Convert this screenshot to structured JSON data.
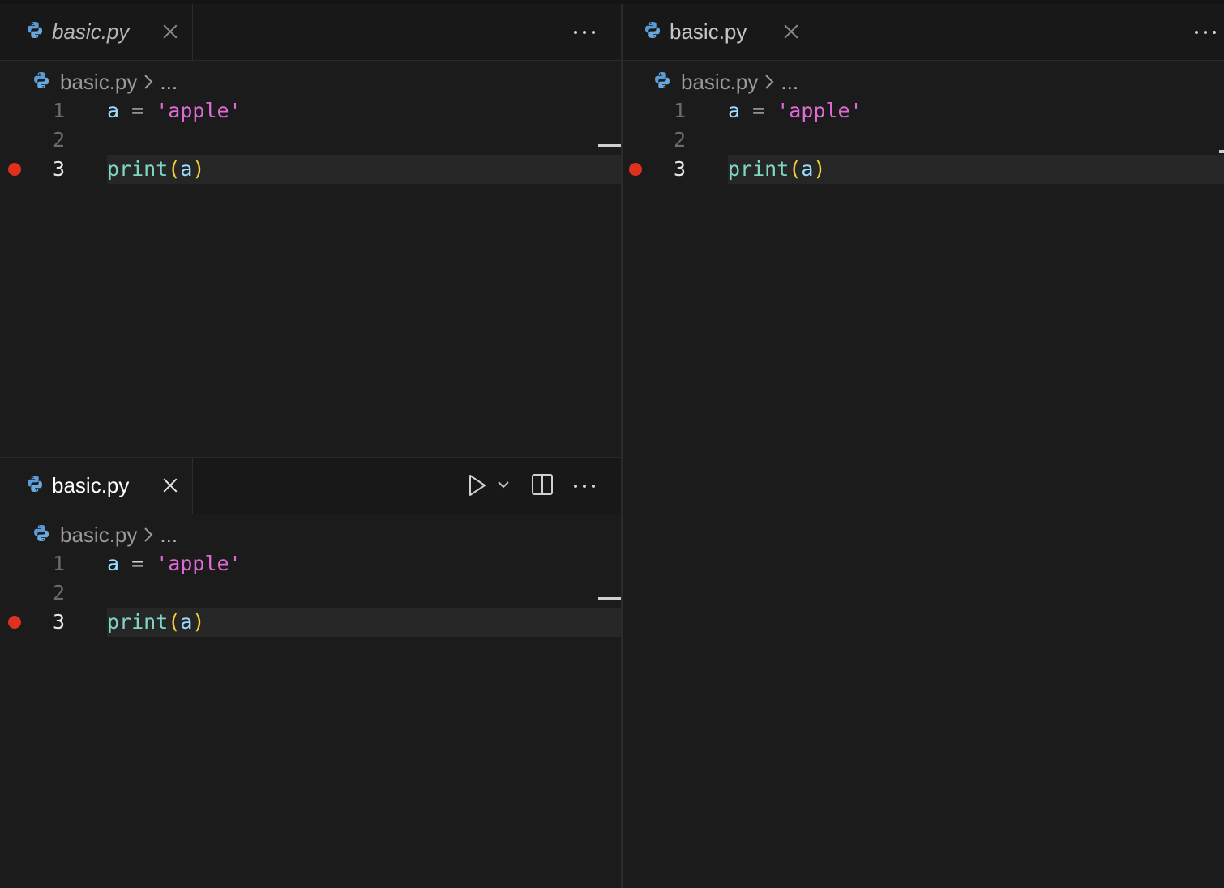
{
  "colors": {
    "breakpoint": "#e0301e",
    "string": "#e06bd8",
    "variable": "#9cdcfe",
    "function": "#7fd6c7",
    "paren": "#f3d23a",
    "background": "#1b1b1b"
  },
  "icons": {
    "file": "python-icon",
    "close": "close-icon",
    "more": "more-actions-icon",
    "run": "run-icon",
    "run_dropdown": "chevron-down-icon",
    "split": "split-editor-icon",
    "breadcrumb_sep": "chevron-right-icon",
    "breakpoint": "breakpoint-icon"
  },
  "top_left": {
    "tab_label": "basic.py",
    "breadcrumb_file": "basic.py",
    "breadcrumb_more": "...",
    "lines": [
      {
        "num": "1",
        "var": "a",
        "op": "=",
        "str": "'apple'"
      },
      {
        "num": "2"
      },
      {
        "num": "3",
        "fn": "print",
        "open": "(",
        "arg": "a",
        "close": ")",
        "breakpoint": true,
        "current": true
      }
    ]
  },
  "right": {
    "tab_label": "basic.py",
    "breadcrumb_file": "basic.py",
    "breadcrumb_more": "...",
    "lines": [
      {
        "num": "1",
        "var": "a",
        "op": "=",
        "str": "'apple'"
      },
      {
        "num": "2"
      },
      {
        "num": "3",
        "fn": "print",
        "open": "(",
        "arg": "a",
        "close": ")",
        "breakpoint": true,
        "current": true
      }
    ]
  },
  "bottom_left": {
    "tab_label": "basic.py",
    "breadcrumb_file": "basic.py",
    "breadcrumb_more": "...",
    "lines": [
      {
        "num": "1",
        "var": "a",
        "op": "=",
        "str": "'apple'"
      },
      {
        "num": "2"
      },
      {
        "num": "3",
        "fn": "print",
        "open": "(",
        "arg": "a",
        "close": ")",
        "breakpoint": true,
        "current": true
      }
    ]
  }
}
